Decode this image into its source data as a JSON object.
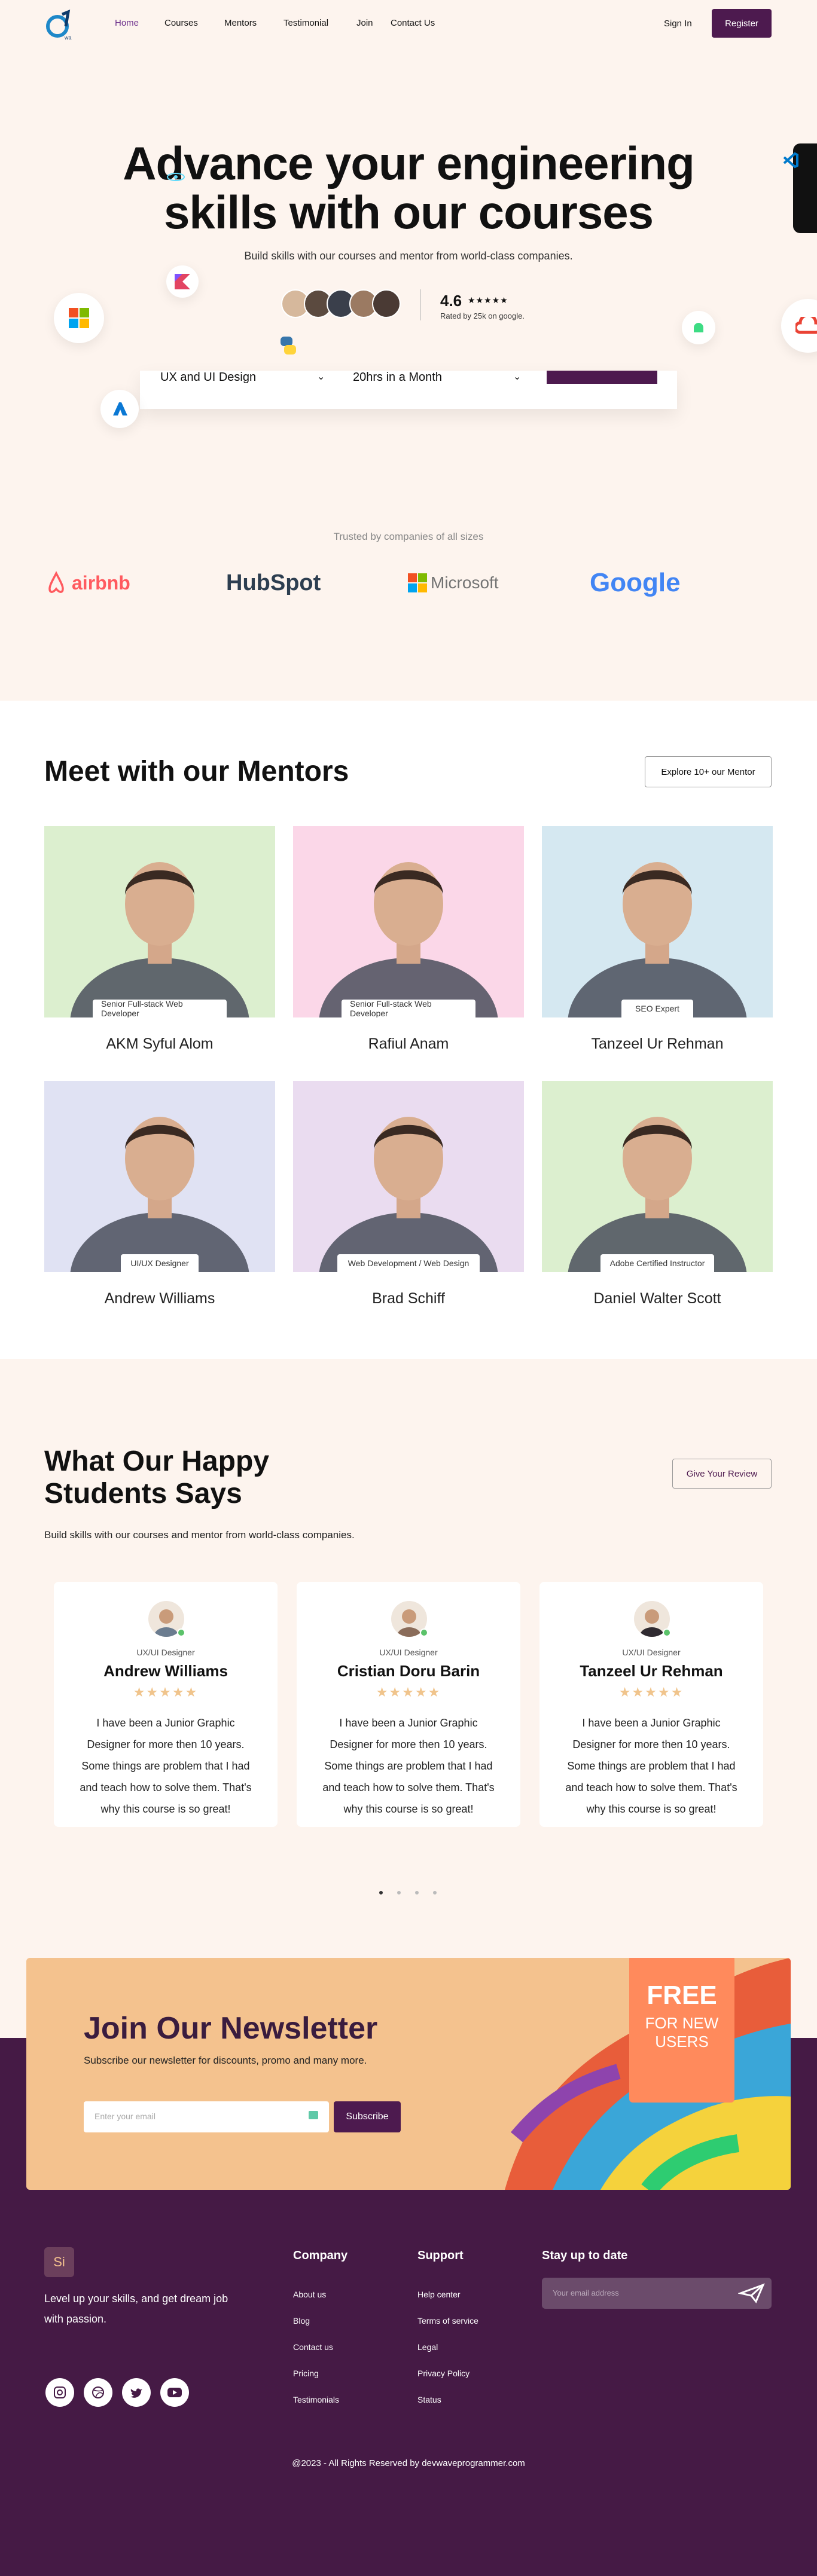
{
  "header": {
    "nav": [
      "Home",
      "Courses",
      "Mentors",
      "Testimonial",
      "Join",
      "Contact Us"
    ],
    "signin": "Sign In",
    "register": "Register"
  },
  "hero": {
    "title_line1": "Advance your engineering",
    "title_line2": "skills with our courses",
    "subtitle": "Build skills with our courses and mentor from world-class companies.",
    "rating_value": "4.6",
    "rating_stars": "★★★★★",
    "rating_text": "Rated by 25k on google.",
    "select_course": "UX and UI Design",
    "select_duration": "20hrs in a Month"
  },
  "trusted": {
    "label": "Trusted by companies of all sizes",
    "brands": [
      "airbnb",
      "HubSpot",
      "Microsoft",
      "Google"
    ]
  },
  "mentors": {
    "title": "Meet with our Mentors",
    "explore": "Explore 10+ our Mentor",
    "items": [
      {
        "role": "Senior Full-stack Web Developer",
        "name": "AKM Syful Alom",
        "bg": "#dcefcf"
      },
      {
        "role": "Senior Full-stack Web Developer",
        "name": "Rafiul Anam",
        "bg": "#fbd7e8"
      },
      {
        "role": "SEO Expert",
        "name": "Tanzeel Ur Rehman",
        "bg": "#d5e8f1"
      },
      {
        "role": "UI/UX Designer",
        "name": "Andrew Williams",
        "bg": "#e0e2f3"
      },
      {
        "role": "Web Development / Web Design",
        "name": "Brad Schiff",
        "bg": "#eadcf0"
      },
      {
        "role": "Adobe Certified Instructor",
        "name": "Daniel Walter Scott",
        "bg": "#dcefcf"
      }
    ]
  },
  "testimonials": {
    "title_line1": "What Our Happy",
    "title_line2": "Students Says",
    "review_button": "Give Your Review",
    "subtitle": "Build skills with our courses and mentor from world-class companies.",
    "items": [
      {
        "role": "UX/UI Designer",
        "name": "Andrew Williams",
        "stars": "★★★★★",
        "quote": "I have been a Junior Graphic Designer for more then 10 years. Some things are problem that I had and teach how to solve them. That's why this course is so great!"
      },
      {
        "role": "UX/UI Designer",
        "name": "Cristian Doru Barin",
        "stars": "★★★★★",
        "quote": "I have been a Junior Graphic Designer for more then 10 years. Some things are problem that I had and teach how to solve them. That's why this course is so great!"
      },
      {
        "role": "UX/UI Designer",
        "name": "Tanzeel Ur Rehman",
        "stars": "★★★★★",
        "quote": "I have been a Junior Graphic Designer for more then 10 years. Some things are problem that I had and teach how to solve them. That's why this course is so great!"
      }
    ]
  },
  "newsletter": {
    "title": "Join Our Newsletter",
    "subtitle": "Subscribe our newsletter for discounts, promo and many more.",
    "placeholder": "Enter your email",
    "button": "Subscribe",
    "badge_line1": "FREE",
    "badge_line2": "FOR NEW",
    "badge_line3": "USERS"
  },
  "footer": {
    "logo_text": "Si",
    "tagline": "Level up your skills, and get dream job with passion.",
    "company_title": "Company",
    "company_links": [
      "About us",
      "Blog",
      "Contact us",
      "Pricing",
      "Testimonials"
    ],
    "support_title": "Support",
    "support_links": [
      "Help center",
      "Terms of service",
      "Legal",
      "Privacy Policy",
      "Status"
    ],
    "stay_title": "Stay up to date",
    "email_placeholder": "Your email address",
    "copyright": "@2023 - All Rights Reserved by devwaveprogrammer.com"
  },
  "colors": {
    "brand": "#4d1a4f",
    "cream": "#fdf4ee",
    "footer": "#451a45",
    "accent_orange": "#ff8a5c"
  }
}
